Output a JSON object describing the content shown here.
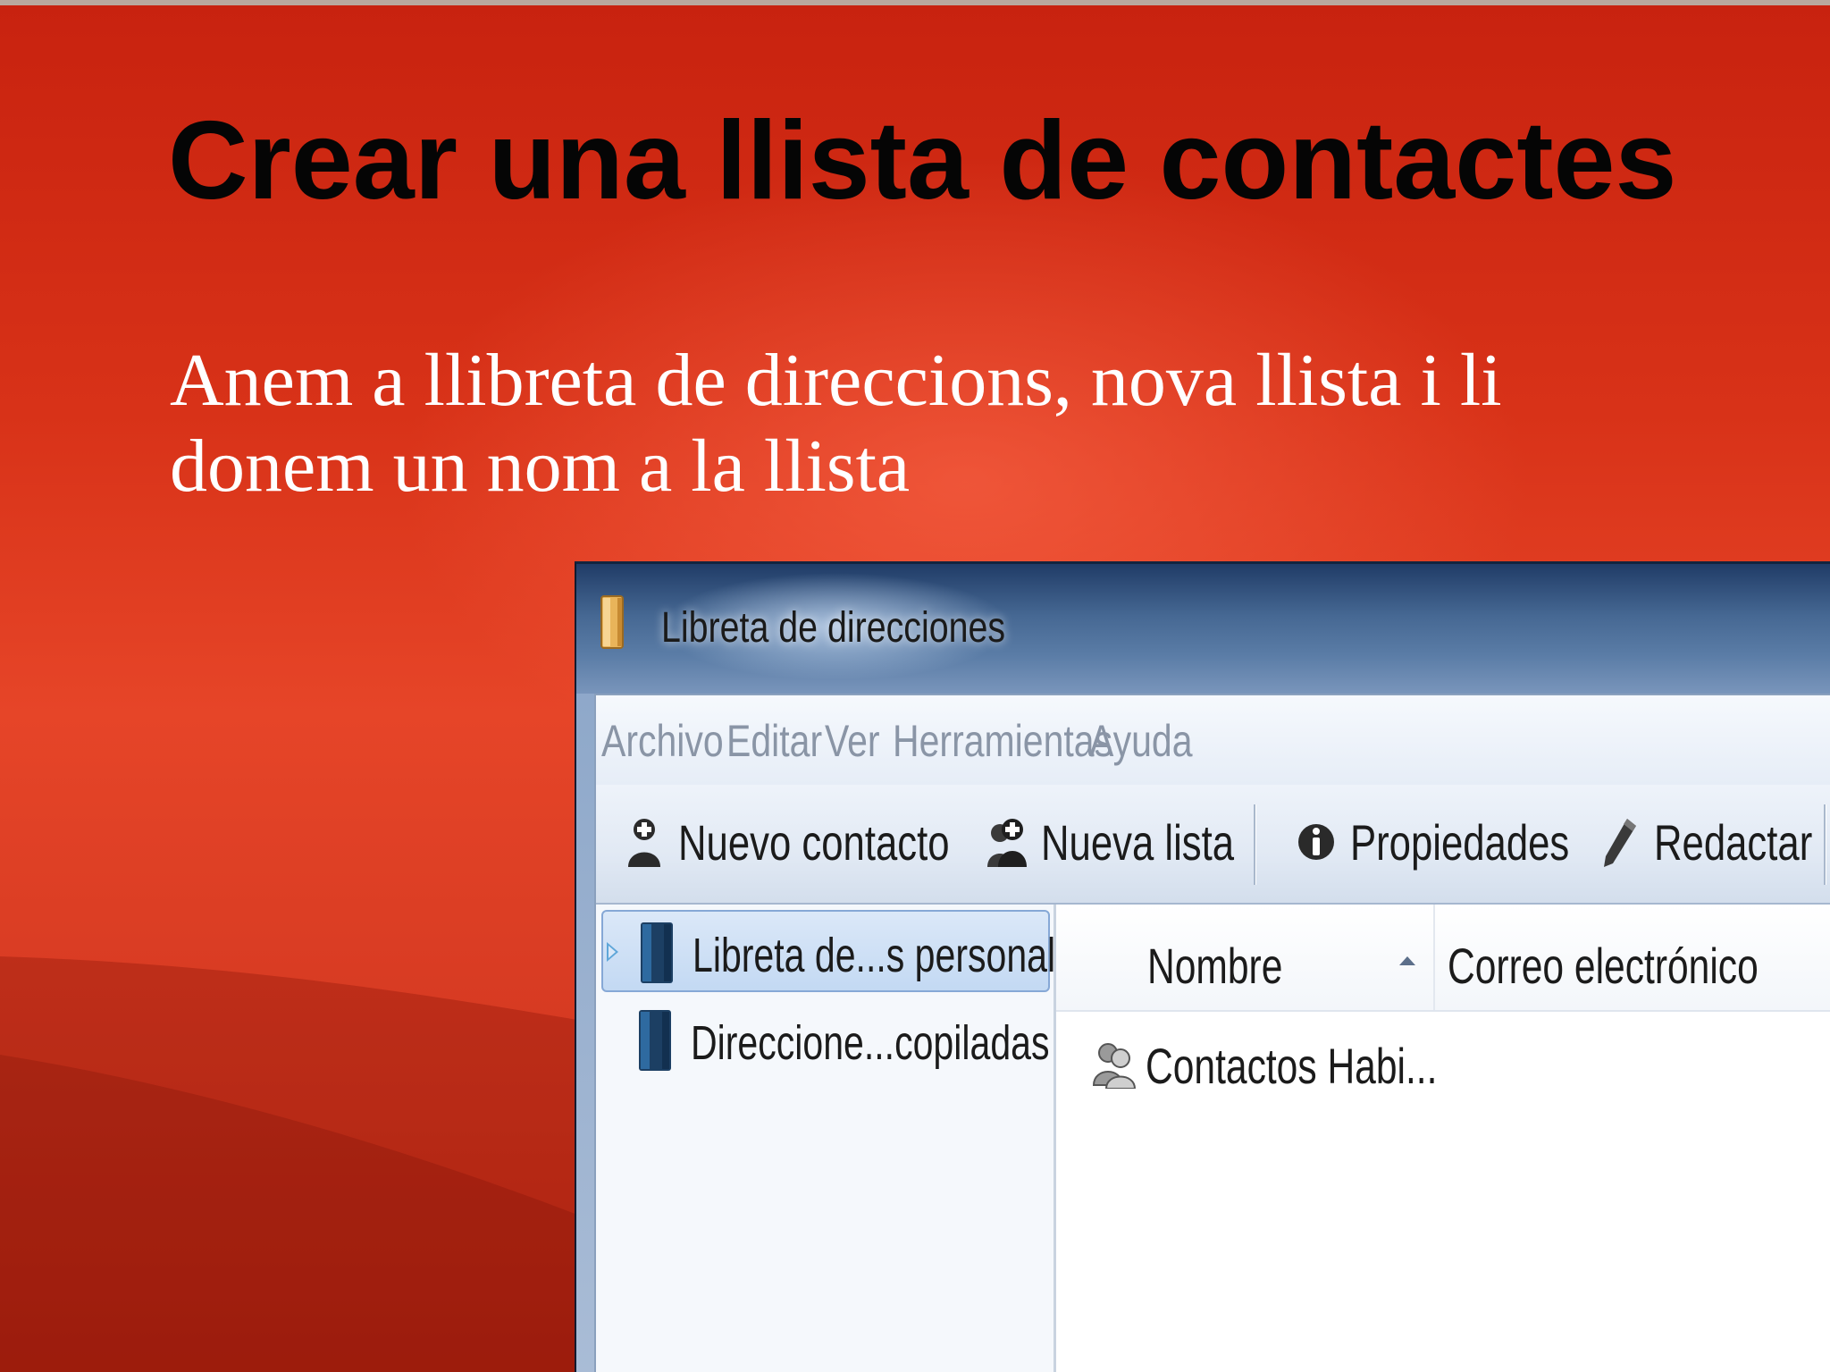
{
  "slide": {
    "title": "Crear una llista de contactes",
    "body_line1": "Anem a llibreta de direccions, nova llista i li",
    "body_line2": "donem un nom a la llista"
  },
  "window": {
    "title": "Libreta de direcciones",
    "menu": [
      "Archivo",
      "Editar",
      "Ver",
      "Herramientas",
      "Ayuda"
    ],
    "toolbar": {
      "new_contact": "Nuevo contacto",
      "new_list": "Nueva lista",
      "properties": "Propiedades",
      "compose": "Redactar"
    },
    "tree": [
      {
        "label": "Libreta de...s personal",
        "selected": true
      },
      {
        "label": "Direccione...copiladas",
        "selected": false
      }
    ],
    "columns": {
      "name": "Nombre",
      "email": "Correo electrónico"
    },
    "rows": [
      {
        "name": "Contactos Habi...",
        "icon": "contact-group-icon"
      }
    ]
  },
  "colors": {
    "slide_red": "#d83218",
    "title_color": "#050505",
    "window_frame": "#1e3d6b",
    "selection": "#c3d9f3"
  }
}
